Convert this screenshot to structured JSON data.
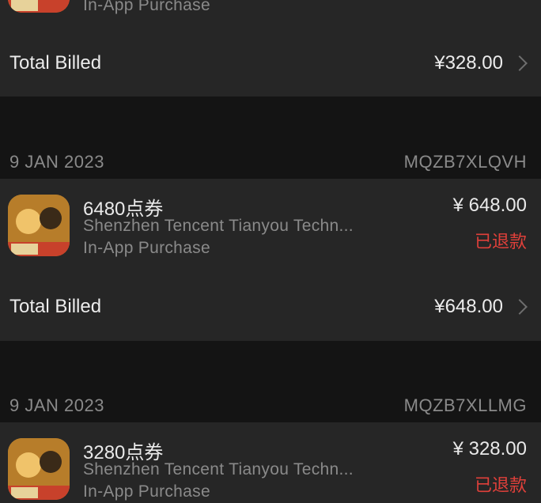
{
  "top_partial": {
    "subtitle": "In-App Purchase",
    "total_label": "Total Billed",
    "total_value": "¥328.00"
  },
  "orders": [
    {
      "date": "9 JAN 2023",
      "order_id": "MQZB7XLQVH",
      "item_title": "6480点券",
      "developer": "Shenzhen Tencent Tianyou Techn...",
      "item_type": "In-App Purchase",
      "price": "¥ 648.00",
      "status": "已退款",
      "total_label": "Total Billed",
      "total_value": "¥648.00"
    },
    {
      "date": "9 JAN 2023",
      "order_id": "MQZB7XLLMG",
      "item_title": "3280点券",
      "developer": "Shenzhen Tencent Tianyou Techn...",
      "item_type": "In-App Purchase",
      "price": "¥ 328.00",
      "status": "已退款"
    }
  ],
  "icons": {
    "app_icon": "game-app-icon",
    "chevron": "chevron-right-icon"
  },
  "colors": {
    "background": "#141414",
    "card": "#262626",
    "primary_text": "#e9e9e9",
    "secondary_text": "#8a8a8a",
    "refund": "#e0403a"
  }
}
